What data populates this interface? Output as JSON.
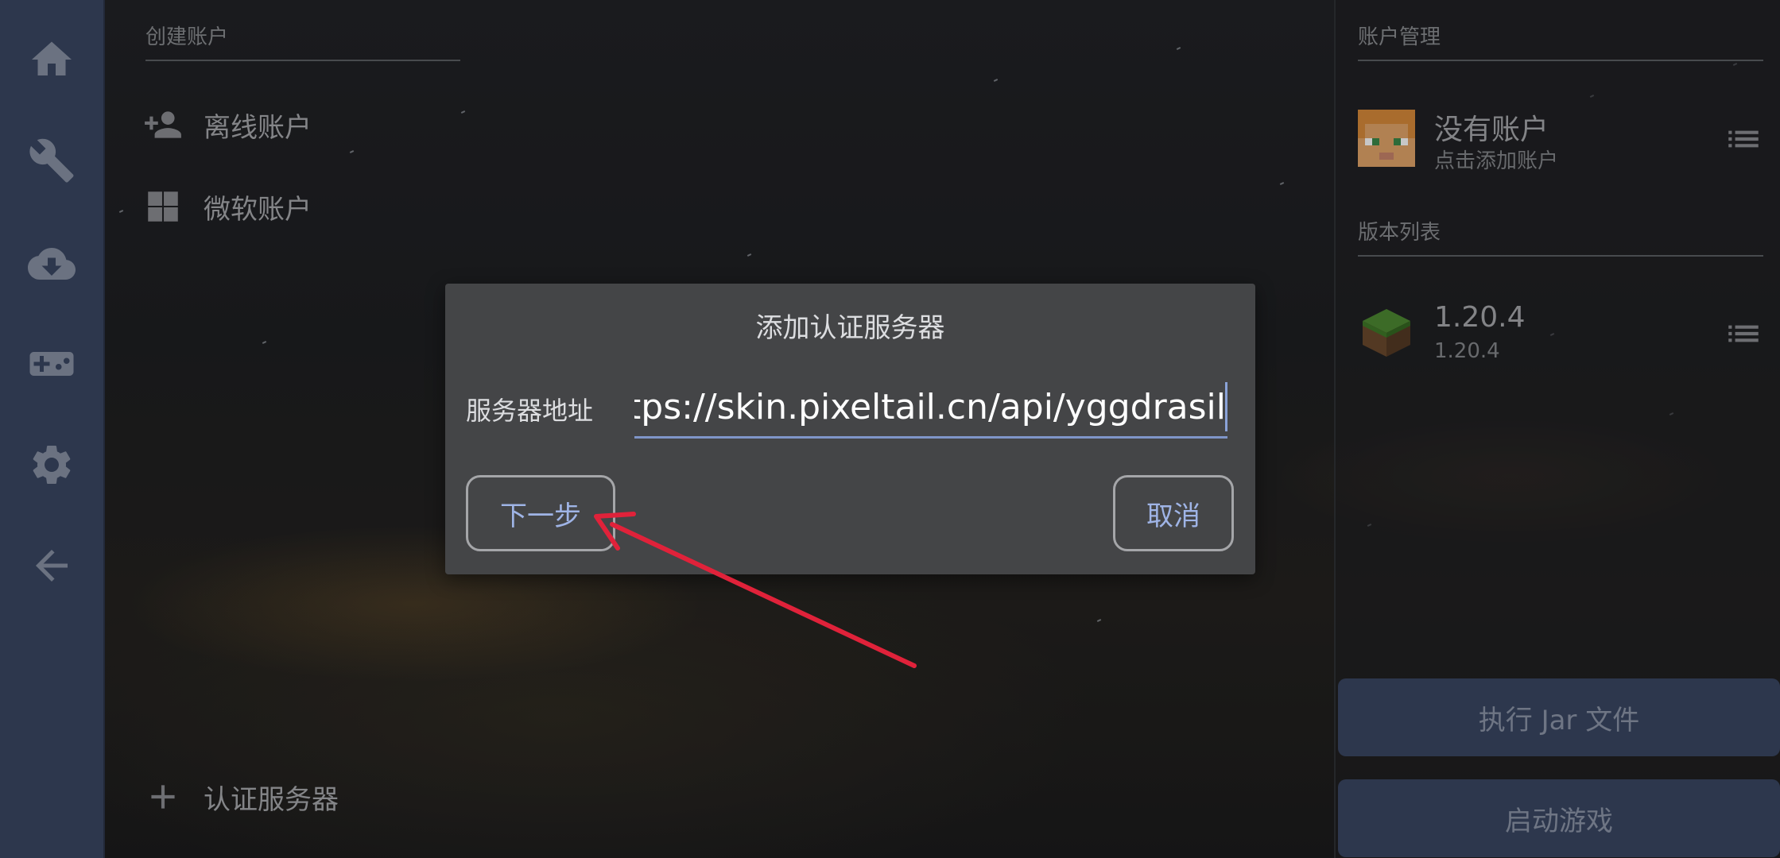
{
  "nav": {
    "items": [
      {
        "name": "home-icon"
      },
      {
        "name": "wrench-icon"
      },
      {
        "name": "cloud-download-icon"
      },
      {
        "name": "gamepad-icon"
      },
      {
        "name": "settings-icon"
      },
      {
        "name": "back-arrow-icon"
      }
    ]
  },
  "left": {
    "section_title": "创建账户",
    "offline_account": "离线账户",
    "microsoft_account": "微软账户",
    "auth_server": "认证服务器"
  },
  "right": {
    "account_section": "账户管理",
    "account_title": "没有账户",
    "account_sub": "点击添加账户",
    "version_section": "版本列表",
    "version_title": "1.20.4",
    "version_sub": "1.20.4",
    "run_jar": "执行 Jar 文件",
    "launch_game": "启动游戏"
  },
  "dialog": {
    "title": "添加认证服务器",
    "label": "服务器地址",
    "value": "https://skin.pixeltail.cn/api/yggdrasil",
    "next": "下一步",
    "cancel": "取消"
  },
  "colors": {
    "nav_bg": "#3a4763",
    "accent": "#7f95c8",
    "annotation_arrow": "#e0223a"
  }
}
